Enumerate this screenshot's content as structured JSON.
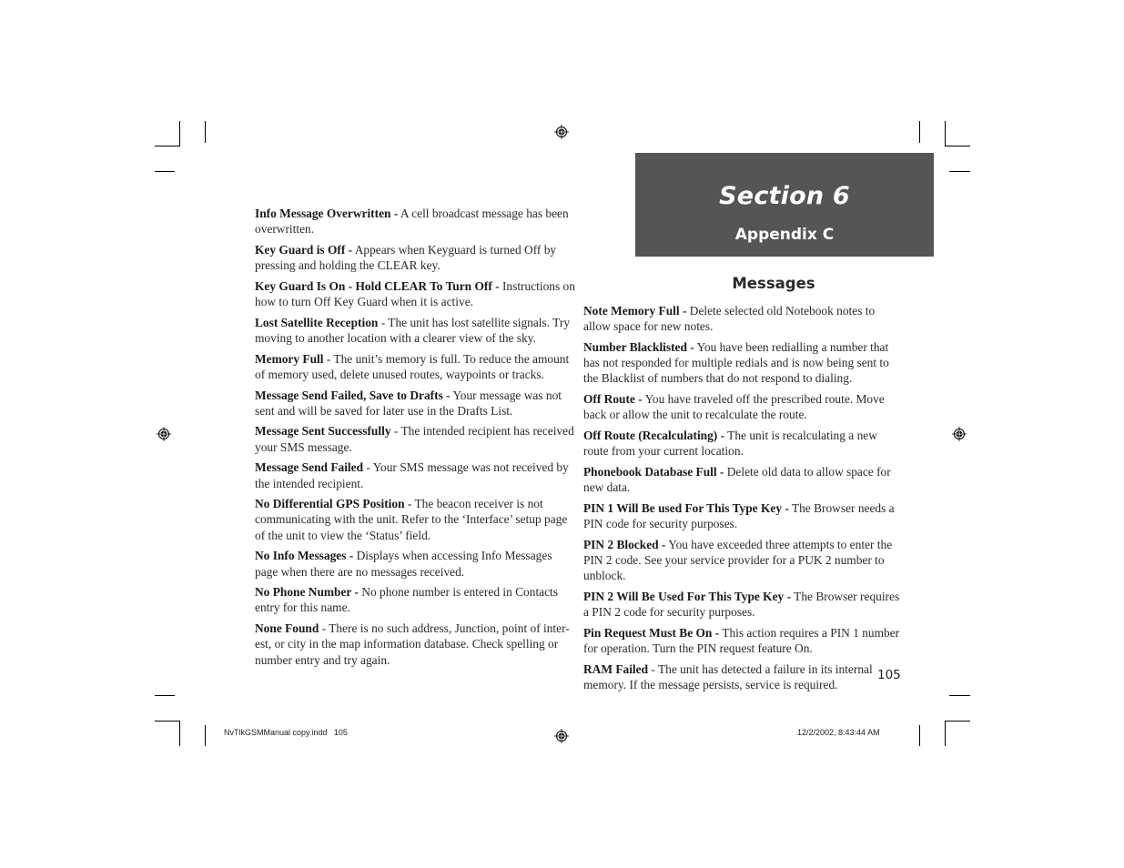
{
  "header": {
    "section_title": "Section 6",
    "section_subtitle": "Appendix C",
    "box_color": "#555555"
  },
  "messages_heading": "Messages",
  "left_column": [
    {
      "term": "Info Message Overwritten -",
      "text": " A cell broadcast message has been overwritten."
    },
    {
      "term": "Key Guard is Off -",
      "text": " Appears when Keyguard is turned Off by pressing and holding the CLEAR key."
    },
    {
      "term": "Key Guard Is On - Hold CLEAR To Turn Off -",
      "text": " Instructions on how to turn Off Key Guard when it is active."
    },
    {
      "term": "Lost Satellite Reception",
      "text": " - The unit has lost satellite signals. Try moving to another location with a clearer view of the sky."
    },
    {
      "term": "Memory Full",
      "text": " - The unit’s memory is full. To reduce the amount of memory used, delete unused routes, waypoints or tracks."
    },
    {
      "term": "Message Send Failed, Save to Drafts -",
      "text": " Your message was not sent and will be saved for later use in the Drafts List."
    },
    {
      "term": "Message Sent Successfully",
      "text": " - The intended recipient has received your SMS message."
    },
    {
      "term": "Message Send Failed",
      "text": " - Your SMS message was not received by the intended recipient."
    },
    {
      "term": "No Differential GPS Position",
      "text": " - The beacon receiver is not communicating with the unit. Refer to the ‘Interface’ setup page of the unit to view the ‘Status’ field."
    },
    {
      "term": "No Info Messages -",
      "text": " Displays when accessing Info Messages page when there are no messages received."
    },
    {
      "term": "No Phone Number -",
      "text": " No phone number is entered in Contacts entry for this name."
    },
    {
      "term": "None Found",
      "text": " - There is no such address, Junction, point of inter-est, or city in the map information database. Check spelling or number entry and try again."
    }
  ],
  "right_column": [
    {
      "term": "Note Memory Full -",
      "text": " Delete selected old Notebook notes to allow space for new notes."
    },
    {
      "term": "Number Blacklisted -",
      "text": " You have been redialling a number that has not responded for multiple redials and is now being sent to the Blacklist of numbers that do not respond to dialing."
    },
    {
      "term": "Off Route -",
      "text": " You have traveled off the prescribed route.  Move back or allow the unit to recalculate the route."
    },
    {
      "term": "Off Route (Recalculating) -",
      "text": " The unit is recalculating a new route from your current location."
    },
    {
      "term": "Phonebook Database Full -",
      "text": " Delete old data to allow space for new data."
    },
    {
      "term": "PIN 1 Will Be used For This Type Key -",
      "text": " The Browser needs a PIN code for security purposes."
    },
    {
      "term": "PIN 2 Blocked -",
      "text": " You have exceeded three attempts to enter the PIN 2 code. See your service provider for a PUK 2 number to unblock."
    },
    {
      "term": "PIN 2 Will Be Used For This Type Key -",
      "text": " The Browser requires a PIN 2 code for security purposes."
    },
    {
      "term": "Pin Request Must Be On -",
      "text": " This action requires a PIN 1 number for operation. Turn the PIN request feature On."
    },
    {
      "term": "RAM Failed",
      "text": " - The unit has detected a failure in its internal memory.  If the message persists, service is required."
    }
  ],
  "page_number": "105",
  "slug": {
    "file": "NvTlkGSMManual copy.indd   105",
    "timestamp": "12/2/2002, 8:43:44 AM"
  }
}
